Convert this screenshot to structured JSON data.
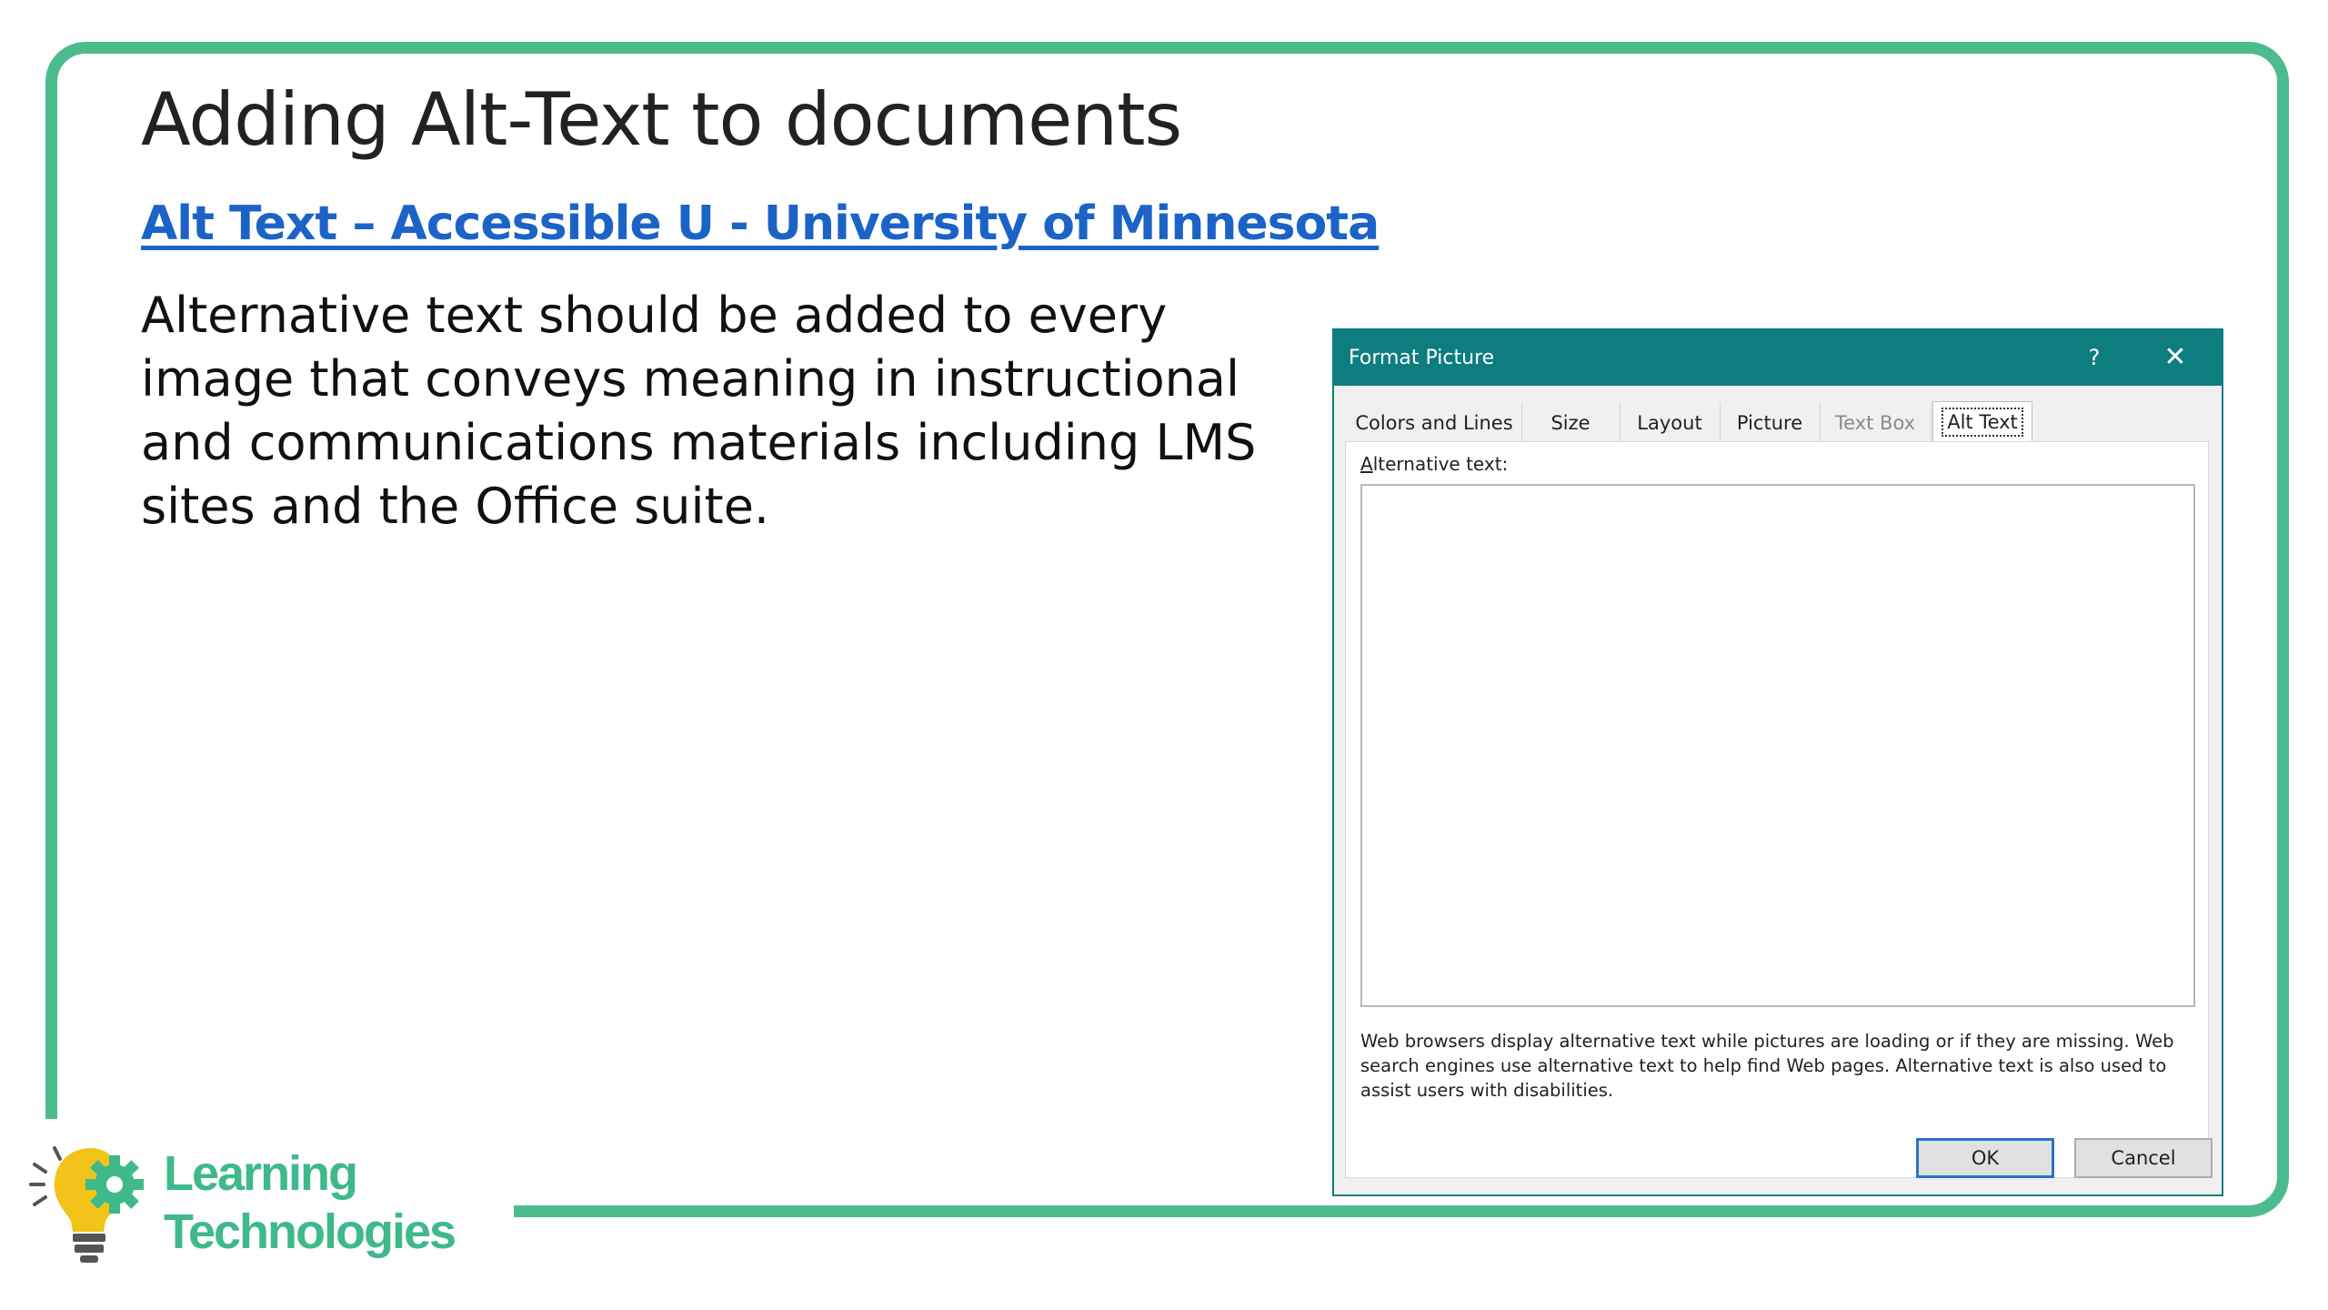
{
  "slide": {
    "title": "Adding Alt-Text to documents",
    "link_text": "Alt Text – Accessible U - University of Minnesota",
    "body": "Alternative text should be added to every image that conveys meaning in instructional and communications materials including LMS sites and the Office suite."
  },
  "logo": {
    "line1": "Learning",
    "line2": "Technologies",
    "icon": "lightbulb-gear-icon"
  },
  "dialog": {
    "title": "Format Picture",
    "help_glyph": "?",
    "close_glyph": "✕",
    "tabs": [
      {
        "label": "Colors and Lines",
        "state": "normal"
      },
      {
        "label": "Size",
        "state": "normal"
      },
      {
        "label": "Layout",
        "state": "normal"
      },
      {
        "label": "Picture",
        "state": "normal"
      },
      {
        "label": "Text Box",
        "state": "disabled"
      },
      {
        "label": "Alt Text",
        "state": "active"
      }
    ],
    "alt_text_label_access_key": "A",
    "alt_text_label_rest": "lternative text:",
    "alt_text_value": "",
    "description": "Web browsers display alternative text while pictures are loading or if they are missing. Web search engines use alternative text to help find Web pages.  Alternative text is also used to assist users with disabilities.",
    "ok_label": "OK",
    "cancel_label": "Cancel"
  },
  "colors": {
    "frame": "#4cbc8f",
    "link": "#1c63c7",
    "dialog_titlebar": "#0e7d80",
    "logo_text": "#3fb98a",
    "bulb": "#f2c318",
    "gear": "#3fb98a"
  }
}
